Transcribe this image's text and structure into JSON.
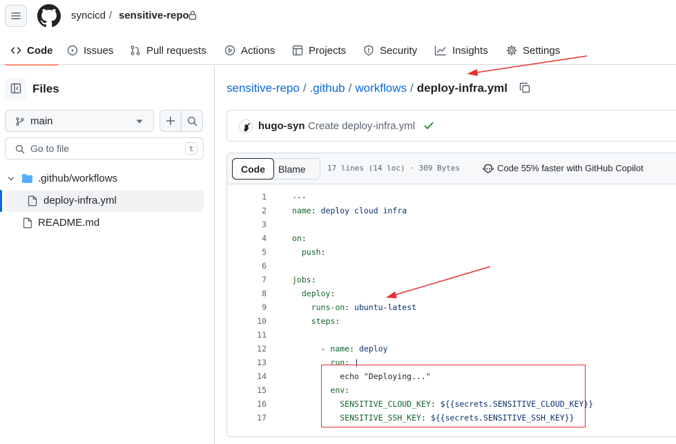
{
  "header": {
    "owner": "syncicd",
    "separator": "/",
    "repo": "sensitive-repo"
  },
  "nav": {
    "tabs": [
      {
        "label": "Code",
        "icon": "code-icon",
        "active": true
      },
      {
        "label": "Issues",
        "icon": "issue-icon"
      },
      {
        "label": "Pull requests",
        "icon": "pull-request-icon"
      },
      {
        "label": "Actions",
        "icon": "play-icon"
      },
      {
        "label": "Projects",
        "icon": "table-icon"
      },
      {
        "label": "Security",
        "icon": "shield-icon"
      },
      {
        "label": "Insights",
        "icon": "graph-icon"
      },
      {
        "label": "Settings",
        "icon": "gear-icon"
      }
    ]
  },
  "sidebar": {
    "title": "Files",
    "branch": "main",
    "goto_placeholder": "Go to file",
    "goto_shortcut": "t",
    "tree": [
      {
        "label": ".github/workflows",
        "type": "folder",
        "expanded": true
      },
      {
        "label": "deploy-infra.yml",
        "type": "file",
        "selected": true
      },
      {
        "label": "README.md",
        "type": "file"
      }
    ]
  },
  "breadcrumb": {
    "parts": [
      "sensitive-repo",
      ".github",
      "workflows"
    ],
    "separator": "/",
    "current": "deploy-infra.yml"
  },
  "commit": {
    "author": "hugo-syn",
    "message": "Create deploy-infra.yml",
    "status": "success"
  },
  "file_header": {
    "code_tab": "Code",
    "blame_tab": "Blame",
    "meta": "17 lines (14 loc) · 309 Bytes",
    "copilot": "Code 55% faster with GitHub Copilot"
  },
  "code": [
    {
      "n": "1",
      "t": "---"
    },
    {
      "n": "2",
      "t": "name: deploy cloud infra"
    },
    {
      "n": "3",
      "t": ""
    },
    {
      "n": "4",
      "t": "on:"
    },
    {
      "n": "5",
      "t": "  push:"
    },
    {
      "n": "6",
      "t": ""
    },
    {
      "n": "7",
      "t": "jobs:"
    },
    {
      "n": "8",
      "t": "  deploy:"
    },
    {
      "n": "9",
      "t": "    runs-on: ubuntu-latest"
    },
    {
      "n": "10",
      "t": "    steps:"
    },
    {
      "n": "11",
      "t": ""
    },
    {
      "n": "12",
      "t": "      - name: deploy"
    },
    {
      "n": "13",
      "t": "        run: |"
    },
    {
      "n": "14",
      "t": "          echo \"Deploying...\""
    },
    {
      "n": "15",
      "t": "        env:"
    },
    {
      "n": "16",
      "t": "          SENSITIVE_CLOUD_KEY: ${{secrets.SENSITIVE_CLOUD_KEY}}"
    },
    {
      "n": "17",
      "t": "          SENSITIVE_SSH_KEY: ${{secrets.SENSITIVE_SSH_KEY}}"
    }
  ],
  "colors": {
    "accent": "#0969da",
    "active_tab_underline": "#fd8c73",
    "annotation": "#e8302f",
    "success": "#1a7f37"
  }
}
